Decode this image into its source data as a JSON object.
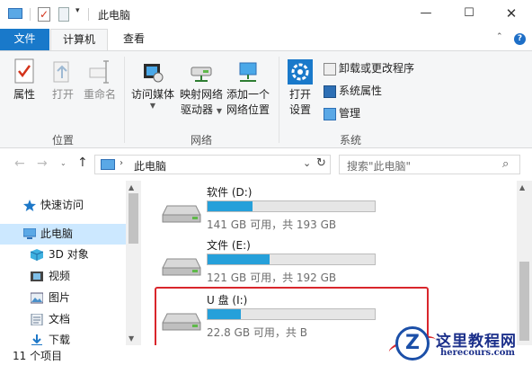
{
  "window": {
    "title": "此电脑",
    "controls": {
      "minimize": "—",
      "maximize": "☐",
      "close": "✕"
    }
  },
  "quick_access_toolbar": {
    "dropdown": "▾"
  },
  "ribbon_tabs": {
    "file": "文件",
    "computer": "计算机",
    "view": "查看",
    "collapse": "⌃",
    "help": "?"
  },
  "ribbon": {
    "location_group": {
      "label": "位置",
      "properties": "属性",
      "open": "打开",
      "rename": "重命名"
    },
    "network_group": {
      "label": "网络",
      "access_media": "访问媒体",
      "map_drive_line1": "映射网络",
      "map_drive_line2": "驱动器",
      "add_location_line1": "添加一个",
      "add_location_line2": "网络位置"
    },
    "system_group": {
      "label": "系统",
      "open_settings_line1": "打开",
      "open_settings_line2": "设置",
      "uninstall": "卸载或更改程序",
      "system_properties": "系统属性",
      "manage": "管理"
    }
  },
  "address_bar": {
    "path": "此电脑",
    "chevron": "›",
    "dropdown": "⌄",
    "refresh": "↻",
    "search_placeholder": "搜索\"此电脑\"",
    "search_icon": "⌕"
  },
  "nav_buttons": {
    "back": "←",
    "forward": "→",
    "recent": "⌄",
    "up": "↑"
  },
  "nav_pane": {
    "items": [
      {
        "label": "快速访问",
        "icon": "star-icon"
      },
      {
        "label": "此电脑",
        "icon": "pc-icon",
        "selected": true
      },
      {
        "label": "3D 对象",
        "icon": "cube-icon"
      },
      {
        "label": "视频",
        "icon": "video-icon"
      },
      {
        "label": "图片",
        "icon": "picture-icon"
      },
      {
        "label": "文档",
        "icon": "document-icon"
      },
      {
        "label": "下载",
        "icon": "download-icon"
      }
    ],
    "scroll_up": "▲",
    "scroll_down": "▼"
  },
  "drives": [
    {
      "name": "软件 (D:)",
      "info": "141 GB 可用，共 193 GB",
      "used_fraction": 0.27
    },
    {
      "name": "文件 (E:)",
      "info": "121 GB 可用，共 192 GB",
      "used_fraction": 0.37
    },
    {
      "name": "U 盘 (I:)",
      "info": "22.8 GB 可用，共   B",
      "used_fraction": 0.2
    }
  ],
  "content_scroll": {
    "up": "▲",
    "down": "▼"
  },
  "status_bar": {
    "text": "11 个项目"
  },
  "watermark": {
    "logo_letter": "Z",
    "title": "这里教程网",
    "url": "herecours.com"
  },
  "colors": {
    "accent": "#1979ca",
    "selection": "#cce8ff",
    "drive_bar": "#26a0da",
    "highlight": "#d9262c"
  }
}
